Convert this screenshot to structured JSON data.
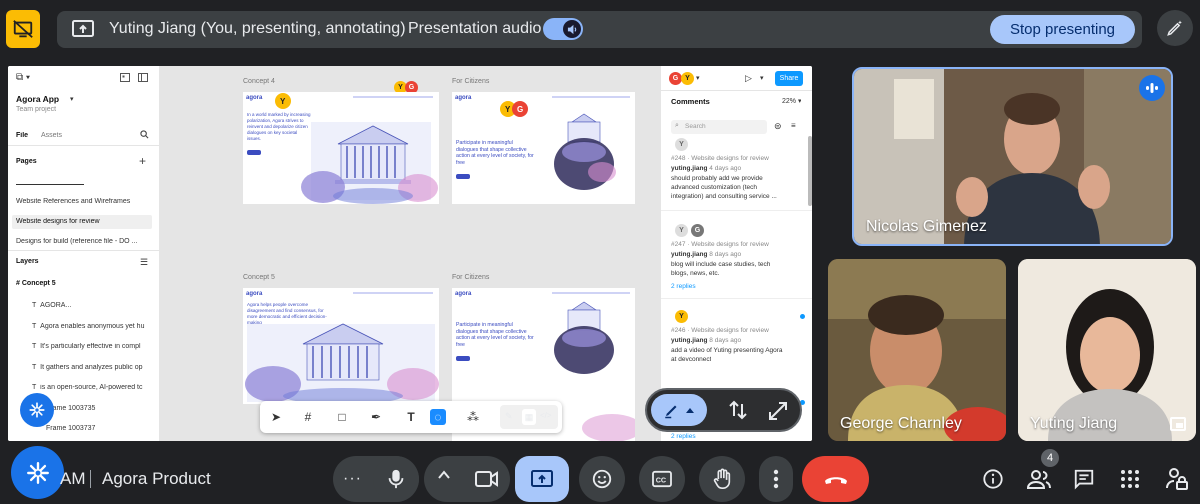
{
  "banner": {
    "title": "Yuting Jiang (You, presenting, annotating)",
    "audio_label": "Presentation audio",
    "stop_label": "Stop presenting"
  },
  "figma": {
    "file_name": "Agora App",
    "team": "Team project",
    "tab_file": "File",
    "tab_assets": "Assets",
    "pages_header": "Pages",
    "pages": [
      "Website References and Wireframes",
      "Website designs for review",
      "Designs for build (reference file - DO ..."
    ],
    "layers_header": "Layers",
    "layer_root": "Concept 5",
    "layers": [
      "AGORA...",
      "Agora enables anonymous yet hu",
      "It's particularly effective in compl",
      "It gathers and analyzes public op",
      "is an open-source, AI-powered tc",
      "Frame 1003735",
      "Frame 1003737"
    ],
    "frames": [
      {
        "label": "Concept 4",
        "brand": "agora",
        "text": "In a world marked by increasing polarization, Agora strives to reinvent and depolarize citizen dialogues on key societal issues."
      },
      {
        "label": "For Citizens",
        "brand": "agora",
        "text": "Participate in meaningful dialogues that shape collective action at every level of society, for free"
      },
      {
        "label": "Concept 5",
        "brand": "agora",
        "text": "Agora helps people overcome disagreement and find consensus, for more democratic and efficient decision-making"
      },
      {
        "label": "For Citizens",
        "brand": "agora",
        "text": "Participate in meaningful dialogues that shape collective action at every level of society, for free"
      }
    ],
    "share_label": "Share",
    "comments_header": "Comments",
    "zoom": "22%",
    "search_placeholder": "Search",
    "comments": [
      {
        "meta": "#248 · Website designs for review",
        "author": "yuting.jiang",
        "time": "4 days ago",
        "text": [
          "should probably add we provide",
          "advanced customization (tech",
          "integration) and consulting service ..."
        ],
        "replies": ""
      },
      {
        "meta": "#247 · Website designs for review",
        "author": "yuting.jiang",
        "time": "8 days ago",
        "text": [
          "blog will include case studies, tech",
          "blogs, news, etc."
        ],
        "replies": "2 replies"
      },
      {
        "meta": "#246 · Website designs for review",
        "author": "yuting.jiang",
        "time": "8 days ago",
        "text": [
          "add a video of Yuting presenting Agora",
          "at devconnect"
        ],
        "replies": ""
      }
    ],
    "more_replies": "2 replies"
  },
  "participants": [
    {
      "name": "Nicolas Gimenez"
    },
    {
      "name": "George Charnley"
    },
    {
      "name": "Yuting Jiang"
    }
  ],
  "bottom": {
    "time_fragment": "AM",
    "meeting_title": "Agora Product",
    "people_count": "4"
  },
  "colors": {
    "accent": "#1a73e8",
    "stop_bg": "#a8c7fa",
    "hangup": "#ea4335",
    "present_off": "#fbbc04",
    "active_share": "#a8c7fa"
  }
}
